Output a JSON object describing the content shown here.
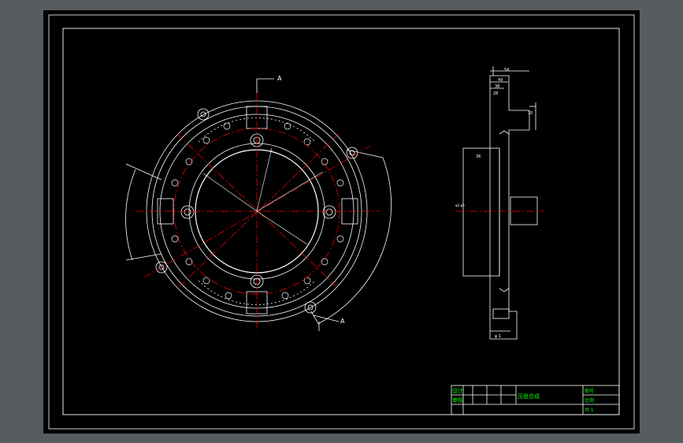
{
  "colors": {
    "background": "#575c61",
    "sheet": "#000000",
    "outline": "#ffffff",
    "centerline": "#ff0000",
    "title_block_text": "#00ff00"
  },
  "section_labels": {
    "top": "A",
    "bottom": "A"
  },
  "dimensions": {
    "right_view_top": "54",
    "right_view_sub1": "49",
    "right_view_sub2": "38",
    "right_view_sub3": "28",
    "right_view_side": "10",
    "right_view_left": "36",
    "right_view_center": "φ2 φ5",
    "right_view_bottom": "φ 1"
  },
  "title_block": {
    "r1c1": "设计",
    "r2c1": "审核",
    "name": "压盘总成",
    "mark1": "图号",
    "mark2": "比例",
    "mark3": "共 1"
  }
}
